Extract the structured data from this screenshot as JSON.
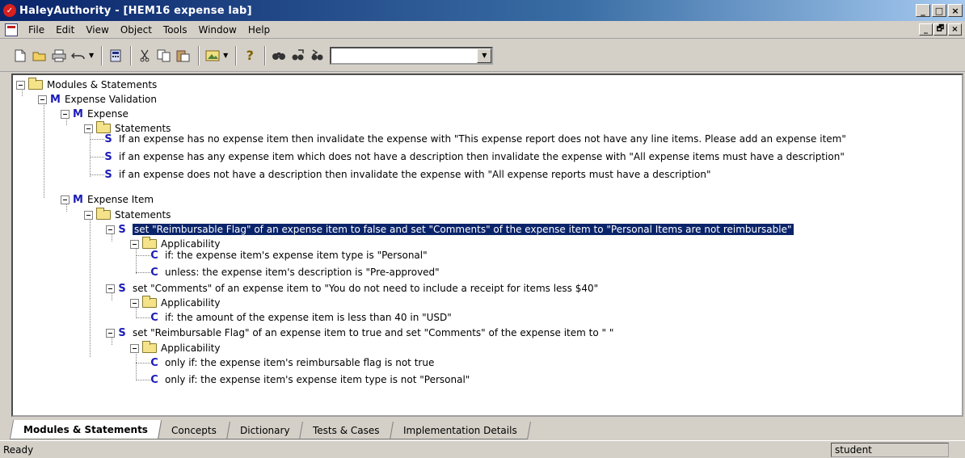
{
  "window": {
    "app_name": "HaleyAuthority",
    "title": "HaleyAuthority - [HEM16 expense lab]",
    "controls": {
      "minimize": "_",
      "maximize": "□",
      "close": "×",
      "restore": "🗗"
    }
  },
  "menu": [
    "File",
    "Edit",
    "View",
    "Object",
    "Tools",
    "Window",
    "Help"
  ],
  "toolbar": {
    "icons": [
      "new-icon",
      "open-icon",
      "print-icon",
      "undo-icon",
      "calculator-icon",
      "cut-icon",
      "copy-icon",
      "paste-icon",
      "image-icon",
      "help-icon",
      "find-icon",
      "find-next-icon",
      "find-replace-icon"
    ],
    "search_value": ""
  },
  "tree": {
    "root": "Modules & Statements",
    "module1": {
      "badge": "M",
      "name": "Expense Validation",
      "submodule1": {
        "badge": "M",
        "name": "Expense",
        "folder": "Statements",
        "statements": [
          "If an expense has no expense item then invalidate the expense with \"This expense report does not have any line items. Please add an expense item\"",
          "if an expense has any expense item which does not have a description then invalidate the expense with \"All expense items must have a description\"",
          "if an expense does not have a description then invalidate the expense with \"All expense reports must have a description\""
        ]
      },
      "submodule2": {
        "badge": "M",
        "name": "Expense Item",
        "folder": "Statements",
        "stmt1": "set \"Reimbursable Flag\" of an expense item to false and set \"Comments\" of the expense item to \"Personal Items are not reimbursable\"",
        "stmt1_applicability": "Applicability",
        "stmt1_conditions": [
          "if: the expense item's expense item type is \"Personal\"",
          "unless: the expense item's description is \"Pre-approved\""
        ],
        "stmt2": "set \"Comments\" of an expense item to \"You do not need to include a receipt for items less $40\"",
        "stmt2_applicability": "Applicability",
        "stmt2_conditions": [
          "if: the amount of the expense item is less than 40 in \"USD\""
        ],
        "stmt3": "set \"Reimbursable Flag\" of an expense item to true and set \"Comments\" of the expense item to \" \"",
        "stmt3_applicability": "Applicability",
        "stmt3_conditions": [
          "only if: the expense item's reimbursable flag is not true",
          "only if: the expense item's expense item type is not \"Personal\""
        ]
      }
    },
    "badges": {
      "s": "S",
      "c": "C"
    }
  },
  "tabs": [
    "Modules & Statements",
    "Concepts",
    "Dictionary",
    "Tests & Cases",
    "Implementation Details"
  ],
  "status": {
    "text": "Ready",
    "user": "student"
  }
}
